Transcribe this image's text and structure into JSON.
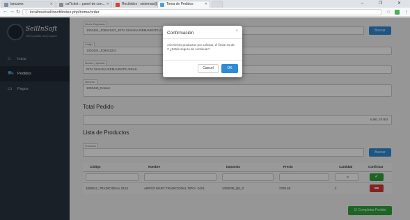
{
  "browser": {
    "tabs": [
      {
        "label": "lancamx",
        "color": "#7b8fa6",
        "active": false
      },
      {
        "label": "osTicket :: panel de con...",
        "color": "#8a8a8a",
        "active": false
      },
      {
        "label": "Recibidos - sistemas@...",
        "color": "#d44638",
        "active": false
      },
      {
        "label": "Toma de Pedidos",
        "color": "#4ea1db",
        "active": true
      }
    ],
    "url": "localhost/sellinsoft/index.php/home/order",
    "window_buttons": "– ❐ ✕"
  },
  "sidebar": {
    "brand_title": "SellInSoft",
    "brand_subtitle": "Vive tu pedido, fácil y seguro",
    "items": [
      {
        "label": "Inicio",
        "icon": "home-icon",
        "active": false
      },
      {
        "label": "Pedidos",
        "icon": "cart-icon",
        "active": true
      },
      {
        "label": "Pagos",
        "icon": "card-icon",
        "active": false
      }
    ]
  },
  "form": {
    "client_search_label": "Cliente Registrado",
    "client_search_value": "1002424_JO6041221_RITA SUSANA REMAVENTE A",
    "search_button": "Buscar",
    "code_label": "Código",
    "code_value": "1002424_JO6041221",
    "name_label": "Nombre y Apellido",
    "name_value": "RITA SUSANA REMAVENTE ARIAS",
    "address_label": "Dirección",
    "address_value": "1002443_Rosser"
  },
  "total": {
    "title": "Total Pedido",
    "value": "5,561.20 Bsf"
  },
  "products": {
    "title": "Lista de Productos",
    "search_label": "Productos",
    "search_button": "Buscar",
    "columns": [
      "Código",
      "Nombre",
      "Impuesto",
      "Precio",
      "Cantidad",
      "Confirmar"
    ],
    "input_row": {
      "quantity": "0"
    },
    "rows": [
      {
        "code": "1006011_TRADICIONAL 0124",
        "name": "ARROZ MARY TRADICIONAL TIPO I 24X1",
        "tax": "1000036_(E)_0",
        "price": "2780.60",
        "quantity": "2"
      }
    ],
    "complete_button": "Completar Pedido"
  },
  "modal": {
    "title": "Confirmación",
    "close": "×",
    "message": "Aún tienes productos por solicitar, el límite es de: 3 ¿Estás seguro de continuar?",
    "cancel": "Cancel",
    "ok": "OK"
  }
}
